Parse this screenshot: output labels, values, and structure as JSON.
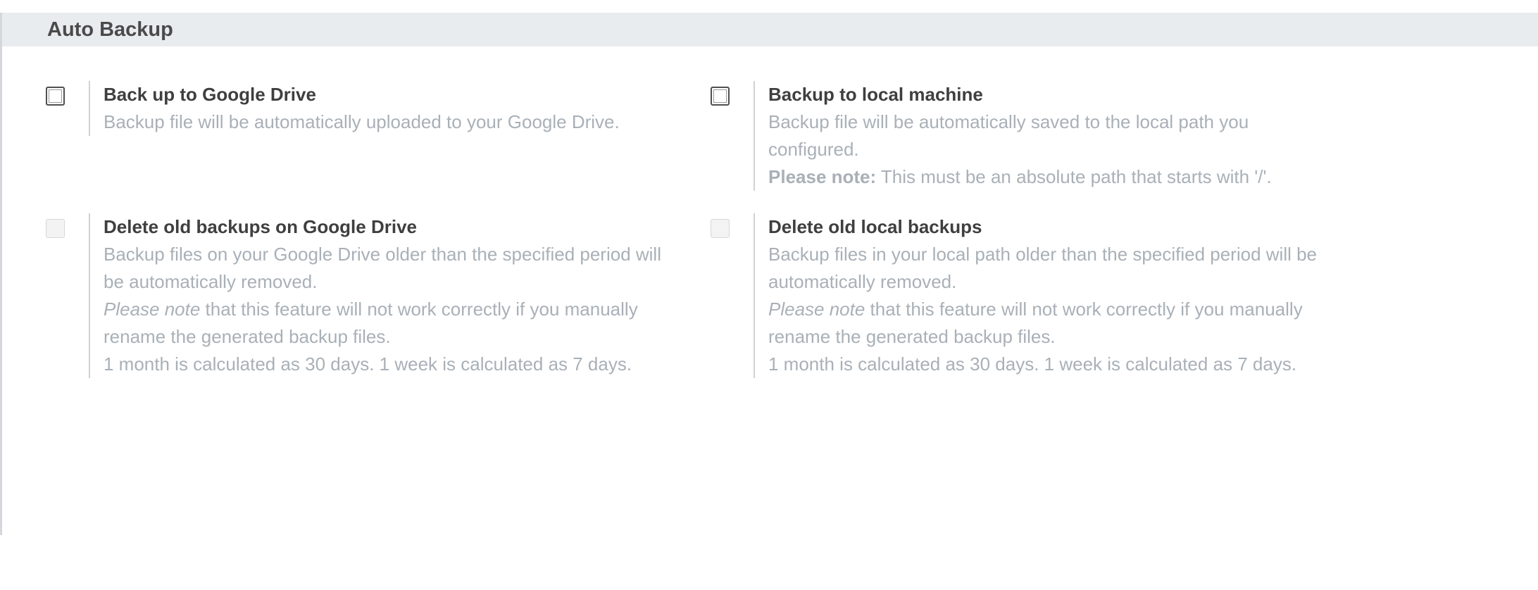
{
  "section": {
    "title": "Auto Backup"
  },
  "settings": {
    "google_drive": {
      "checked": false,
      "disabled": false,
      "title": "Back up to Google Drive",
      "desc_lines": [
        "Backup file will be automatically uploaded to your Google Drive."
      ]
    },
    "local_machine": {
      "checked": false,
      "disabled": false,
      "title": "Backup to local machine",
      "desc_lines": [
        "Backup file will be automatically saved to the local path you",
        "configured."
      ],
      "note_label": "Please note:",
      "note_text": " This must be an absolute path that starts with '/'."
    },
    "delete_drive": {
      "checked": false,
      "disabled": true,
      "title": "Delete old backups on Google Drive",
      "desc_lines": [
        "Backup files on your Google Drive older than the specified period will",
        "be automatically removed."
      ],
      "note_label": "Please note",
      "note_lines": [
        " that this feature will not work correctly if you manually",
        "rename the generated backup files."
      ],
      "extra": "1 month is calculated as 30 days. 1 week is calculated as 7 days."
    },
    "delete_local": {
      "checked": false,
      "disabled": true,
      "title": "Delete old local backups",
      "desc_lines": [
        "Backup files in your local path older than the specified period will be",
        "automatically removed."
      ],
      "note_label": "Please note",
      "note_lines": [
        " that this feature will not work correctly if you manually",
        "rename the generated backup files."
      ],
      "extra": "1 month is calculated as 30 days. 1 week is calculated as 7 days."
    }
  }
}
